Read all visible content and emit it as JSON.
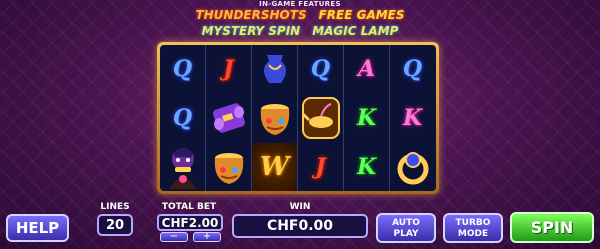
{
  "header": {
    "caption": "IN-GAME FEATURES",
    "features": [
      "THUNDERSHOTS",
      "FREE GAMES",
      "MYSTERY SPIN",
      "MAGIC LAMP"
    ]
  },
  "reels": {
    "rows": [
      [
        "Q",
        "J",
        "",
        "Q",
        "A",
        "Q"
      ],
      [
        "Q",
        "",
        "",
        "",
        "K",
        "K"
      ],
      [
        "",
        "",
        "W",
        "J",
        "K",
        ""
      ]
    ],
    "symbol_icons": {
      "r1c3": "blue-vase-icon",
      "r2c2": "purple-scroll-icon",
      "r2c3": "treasure-pot-icon",
      "r2c4": "magic-lamp-icon",
      "r3c1": "genie-character-icon",
      "r3c2": "treasure-pot-icon",
      "r3c6": "ring-icon"
    }
  },
  "controls": {
    "help_label": "HELP",
    "lines_label": "LINES",
    "lines_value": "20",
    "total_bet_label": "TOTAL BET",
    "total_bet_value": "CHF2.00",
    "bet_minus": "−",
    "bet_plus": "+",
    "win_label": "WIN",
    "win_value": "CHF0.00",
    "auto_play_line1": "AUTO",
    "auto_play_line2": "PLAY",
    "turbo_line1": "TURBO",
    "turbo_line2": "MODE",
    "spin_label": "SPIN"
  },
  "colors": {
    "spin_button": "#3ccf2a",
    "ui_button": "#5a4ae0",
    "frame_gold": "#e0a43a"
  }
}
